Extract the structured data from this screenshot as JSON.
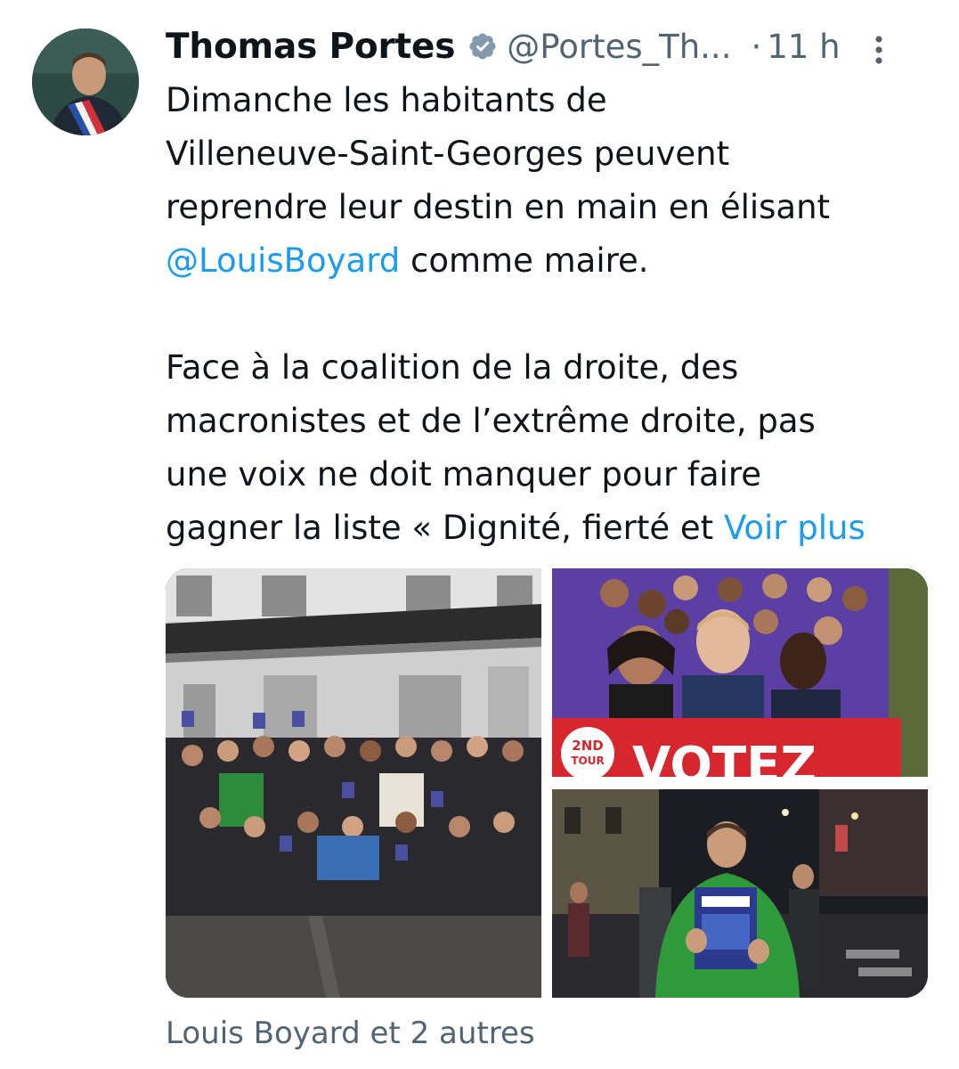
{
  "tweet": {
    "author_name": "Thomas Portes",
    "handle": "@Portes_Th...",
    "separator": "·",
    "time": "11 h",
    "text_part1": "Dimanche les habitants de\nVilleneuve-Saint-Georges peuvent\nreprendre leur destin en main en élisant\n",
    "mention": "@LouisBoyard",
    "text_part2": " comme maire.\n\nFace à la coalition de la droite, des\nmacronistes et de l’extrême droite, pas\nune voix ne doit manquer pour faire\ngagner la liste « Dignité, fierté et ",
    "show_more": "Voir plus",
    "tagged_users": "Louis Boyard et 2 autres"
  },
  "media": {
    "poster_badge_line1": "2ND",
    "poster_badge_line2": "TOUR",
    "poster_word": "VOTEZ"
  },
  "colors": {
    "text": "#0f1419",
    "secondary": "#536471",
    "link": "#1d9bf0",
    "verified_badge": "#829aab"
  },
  "icons": {
    "verified": "verified-badge-icon",
    "more": "more-vertical-icon"
  }
}
